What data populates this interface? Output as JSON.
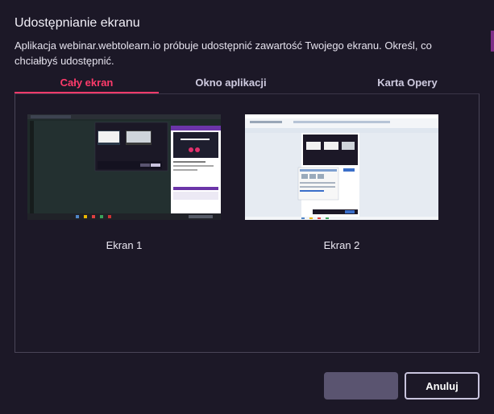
{
  "dialog": {
    "title": "Udostępnianie ekranu",
    "description": "Aplikacja webinar.webtolearn.io próbuje udostępnić zawartość Twojego ekranu. Określ, co chciałbyś udostępnić."
  },
  "tabs": [
    {
      "label": "Cały ekran",
      "active": true
    },
    {
      "label": "Okno aplikacji",
      "active": false
    },
    {
      "label": "Karta Opery",
      "active": false
    }
  ],
  "screens": [
    {
      "label": "Ekran 1",
      "thumbnail_icon": "dark-desktop-thumbnail"
    },
    {
      "label": "Ekran 2",
      "thumbnail_icon": "light-desktop-thumbnail"
    }
  ],
  "buttons": {
    "share_label": "",
    "cancel_label": "Anuluj"
  },
  "colors": {
    "accent": "#ff3b6b",
    "background": "#1c1827"
  }
}
